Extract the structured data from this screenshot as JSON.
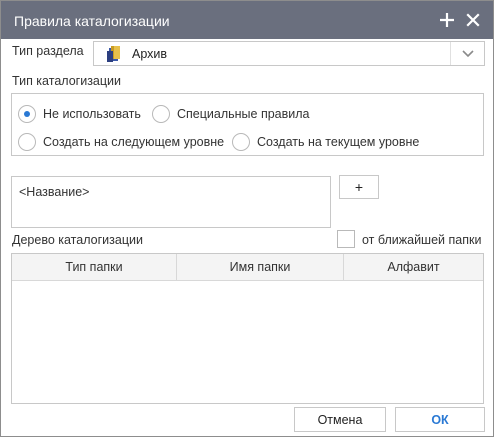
{
  "window": {
    "title": "Правила каталогизации",
    "add_icon": "plus-icon",
    "close_icon": "close-icon"
  },
  "section_type": {
    "label": "Тип раздела",
    "value": "Архив",
    "icon": "archive-icon",
    "arrow_icon": "chevron-down-icon"
  },
  "catalog_type": {
    "label": "Тип каталогизации",
    "options": [
      {
        "label": "Не использовать",
        "selected": true
      },
      {
        "label": "Специальные правила",
        "selected": false
      },
      {
        "label": "Создать на следующем уровне",
        "selected": false
      },
      {
        "label": "Создать на текущем уровне",
        "selected": false
      }
    ]
  },
  "name_field": {
    "value": "<Название>"
  },
  "add_button": {
    "label": "+"
  },
  "tree": {
    "label": "Дерево каталогизации",
    "from_nearest_folder": {
      "label": "от ближайшей папки",
      "checked": false
    },
    "columns": [
      "Тип папки",
      "Имя папки",
      "Алфавит"
    ],
    "rows": []
  },
  "footer": {
    "cancel_label": "Отмена",
    "ok_label": "ОК"
  },
  "colors": {
    "titlebar": "#6a6f7e",
    "accent": "#2a79d4",
    "border": "#c8c8c8"
  }
}
